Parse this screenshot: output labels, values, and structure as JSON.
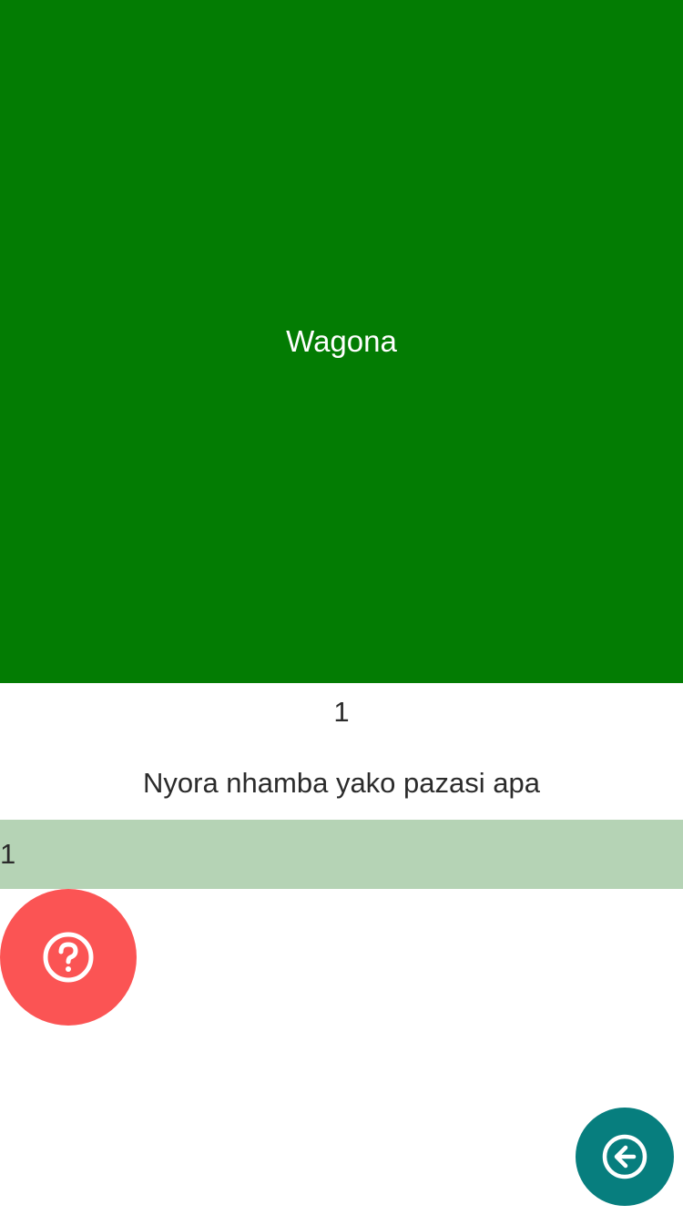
{
  "feedback": {
    "text": "Wagona",
    "color": "#037c03"
  },
  "counter": {
    "value": "1"
  },
  "prompt": {
    "text": "Nyora nhamba yako pazasi apa"
  },
  "answer": {
    "value": "1",
    "background": "#b5d3b5"
  },
  "help_button": {
    "icon": "question-circle-icon",
    "color": "#fb5454"
  },
  "back_button": {
    "icon": "arrow-left-circle-icon",
    "color": "#077e7e"
  }
}
